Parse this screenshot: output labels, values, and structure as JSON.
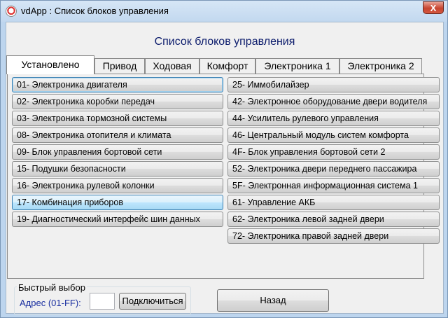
{
  "window": {
    "title": "vdApp :  Список блоков управления",
    "close_symbol": "X"
  },
  "heading": "Список блоков управления",
  "tabs": [
    {
      "label": "Установлено",
      "active": true
    },
    {
      "label": "Привод"
    },
    {
      "label": "Ходовая"
    },
    {
      "label": "Комфорт"
    },
    {
      "label": "Электроника 1"
    },
    {
      "label": "Электроника 2"
    }
  ],
  "modules_left": [
    "01- Электроника двигателя",
    "02- Электроника коробки передач",
    "03- Электроника тормозной системы",
    "08- Электроника отопителя и климата",
    "09- Блок управления бортовой сети",
    "15- Подушки безопасности",
    "16- Электроника рулевой колонки",
    "17- Комбинация приборов",
    "19- Диагностический интерфейс шин данных"
  ],
  "modules_right": [
    "25- Иммобилайзер",
    "42- Электронное оборудование двери водителя",
    "44- Усилитель рулевого управления",
    "46- Центральный модуль систем комфорта",
    "4F- Блок управления бортовой сети 2",
    "52- Электроника двери переднего пассажира",
    "5F- Электронная информационная система 1",
    "61- Управление АКБ",
    "62- Электроника левой задней двери",
    "72- Электроника правой задней двери"
  ],
  "quick_select": {
    "group_label": "Быстрый выбор",
    "address_label": "Адрес (01-FF):",
    "address_value": "",
    "connect_label": "Подключиться"
  },
  "back_label": "Назад",
  "colors": {
    "title_bar": "#c2d8ef",
    "window_border": "#bdd5ee",
    "heading": "#0c1c6c",
    "link_label": "#1a2fa0",
    "hover_button": "#bee6fd"
  }
}
